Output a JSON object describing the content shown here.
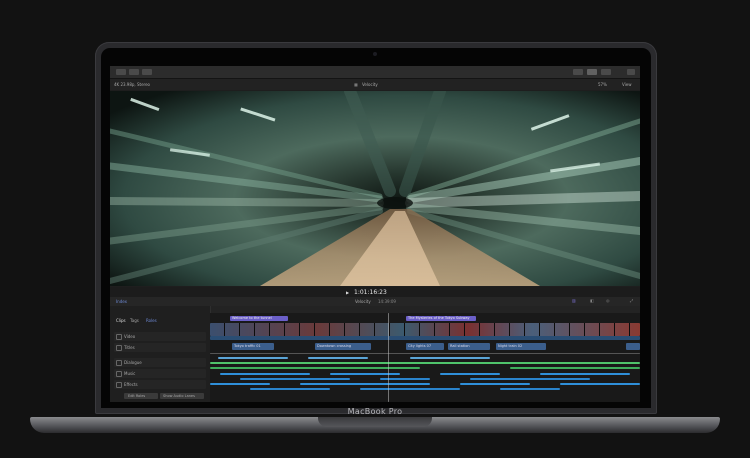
{
  "brand": {
    "name": "MacBook Pro"
  },
  "toolbar": {
    "left_buttons": [
      "back-button",
      "forward-button",
      "library-button"
    ],
    "right_buttons": [
      "layout-button-1",
      "layout-button-2",
      "layout-button-3",
      "share-button"
    ]
  },
  "info_bar": {
    "left": "4K 23.98p, Stereo",
    "center": "Velocity",
    "zoom": "57%",
    "view": "View"
  },
  "transport": {
    "timecode": "1:01:16:23"
  },
  "timeline_header": {
    "index": "Index",
    "project": "Velocity",
    "duration": "14:39:09"
  },
  "sidebar": {
    "tabs": [
      "Clips",
      "Tags",
      "Roles"
    ],
    "items": [
      "Video",
      "Titles",
      "Dialogue",
      "Music",
      "Effects"
    ],
    "buttons": [
      "Edit Roles",
      "Show Audio Lanes"
    ]
  },
  "timeline": {
    "title_clips": [
      "Welcome to the tunnel",
      "The Mysteries of the Tokyo Subway"
    ],
    "connected_clips": [
      "Tokyo traffic 01",
      "Downtown crossing",
      "City lights 07",
      "Rail station",
      "Night train 02"
    ]
  },
  "colors": {
    "video": "#4a6fa5",
    "title": "#7b6fd6",
    "dialogue": "#5aa4d6",
    "music": "#4fc36b",
    "effects": "#2f8fd9"
  }
}
